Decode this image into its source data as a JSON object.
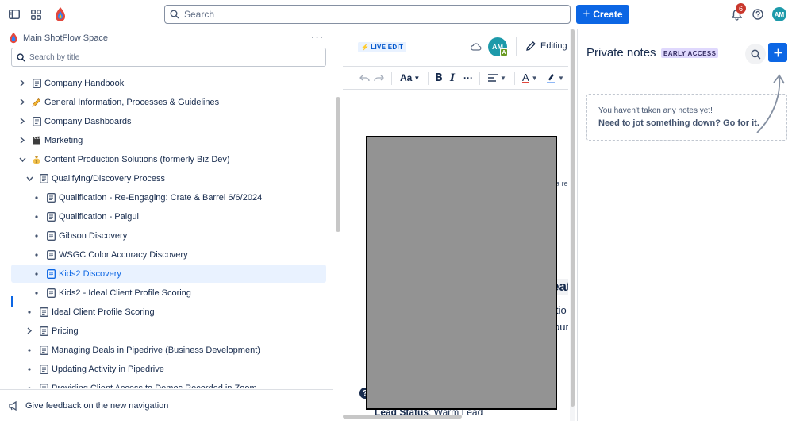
{
  "topbar": {
    "search_placeholder": "Search",
    "create_label": "Create",
    "notifications_count": "6",
    "avatar_initials": "AM"
  },
  "sidebar": {
    "space_title": "Main ShotFlow Space",
    "more_label": "···",
    "search_placeholder": "Search by title",
    "items": [
      {
        "label": "Company Handbook",
        "icon": "page-icon",
        "control": "chevron-right"
      },
      {
        "label": "General Information, Processes & Guidelines",
        "icon": "pencil-emoji-icon",
        "control": "chevron-right"
      },
      {
        "label": "Company Dashboards",
        "icon": "page-icon",
        "control": "chevron-right"
      },
      {
        "label": "Marketing",
        "icon": "clapper-emoji-icon",
        "control": "chevron-right"
      },
      {
        "label": "Content Production Solutions (formerly Biz Dev)",
        "icon": "moneybag-emoji-icon",
        "control": "chevron-down"
      },
      {
        "label": "Qualifying/Discovery Process",
        "icon": "page-icon",
        "control": "chevron-down"
      },
      {
        "label": "Qualification - Re-Engaging: Crate & Barrel 6/6/2024",
        "icon": "page-icon",
        "control": "bullet"
      },
      {
        "label": "Qualification - Paigui",
        "icon": "page-icon",
        "control": "bullet"
      },
      {
        "label": "Gibson Discovery",
        "icon": "page-icon",
        "control": "bullet"
      },
      {
        "label": "WSGC Color Accuracy Discovery",
        "icon": "page-icon",
        "control": "bullet"
      },
      {
        "label": "Kids2 Discovery",
        "icon": "page-icon",
        "control": "bullet",
        "selected": true
      },
      {
        "label": "Kids2 - Ideal Client Profile Scoring",
        "icon": "page-icon",
        "control": "bullet"
      },
      {
        "label": "Ideal Client Profile Scoring",
        "icon": "page-icon",
        "control": "bullet"
      },
      {
        "label": "Pricing",
        "icon": "page-icon",
        "control": "chevron-right"
      },
      {
        "label": "Managing Deals in Pipedrive (Business Development)",
        "icon": "page-icon",
        "control": "bullet"
      },
      {
        "label": "Updating Activity in Pipedrive",
        "icon": "page-icon",
        "control": "bullet"
      },
      {
        "label": "Providing Client Access to Demos Recorded in Zoom",
        "icon": "page-icon",
        "control": "bullet"
      }
    ],
    "feedback_label": "Give feedback on the new navigation"
  },
  "editor": {
    "live_badge": "LIVE EDIT",
    "avatar_initials": "AM",
    "avatar_sub": "A",
    "editing_label": "Editing",
    "text_style_label": "Aa",
    "fragments": {
      "a_re": "a re",
      "eat": "eat",
      "tio": "tio",
      "our": "our",
      "lead_status_label": "Lead Status",
      "lead_status_value": ": Warm Lead"
    }
  },
  "notes": {
    "title": "Private notes",
    "early_access": "EARLY ACCESS",
    "empty_line1": "You haven't taken any notes yet!",
    "empty_line2": "Need to jot something down? Go for it."
  },
  "colors": {
    "accent": "#0c66e4",
    "badge": "#c9372c",
    "avatar": "#1d9aaa",
    "selection": "#e9f2ff"
  }
}
